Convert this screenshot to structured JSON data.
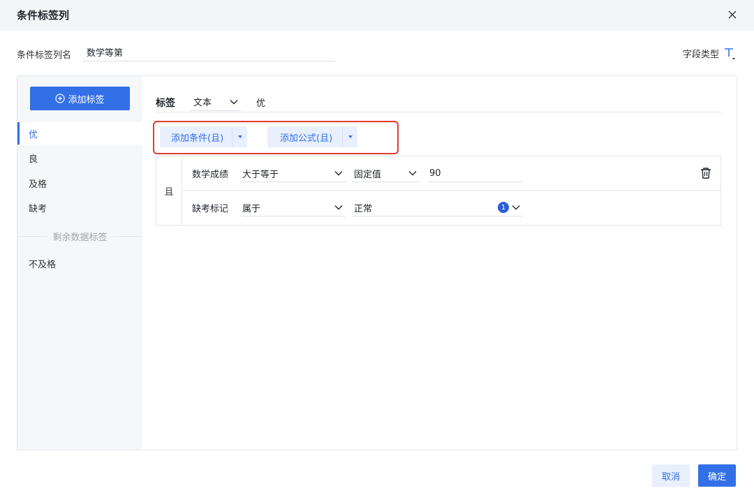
{
  "dialog": {
    "title": "条件标签列",
    "close_icon": "×"
  },
  "column_name": {
    "label": "条件标签列名",
    "value": "数学等第"
  },
  "field_type": {
    "label": "字段类型",
    "icon": "text-type-icon"
  },
  "sidebar": {
    "add_button": "添加标签",
    "tags": [
      "优",
      "良",
      "及格",
      "缺考"
    ],
    "active_index": 0,
    "remaining_label": "剩余数据标签",
    "remaining_tags": [
      "不及格"
    ]
  },
  "label_editor": {
    "title": "标签",
    "type": "文本",
    "value": "优"
  },
  "actions": {
    "add_condition": "添加条件(且)",
    "add_formula": "添加公式(且)",
    "highlight_color": "#e23b2f"
  },
  "conditions": {
    "logic": "且",
    "rows": [
      {
        "field": "数学成绩",
        "operator": "大于等于",
        "value_type": "固定值",
        "value": "90"
      },
      {
        "field": "缺考标记",
        "operator": "属于",
        "value": "正常",
        "selected_count": "1"
      }
    ]
  },
  "footer": {
    "cancel": "取消",
    "confirm": "确定"
  },
  "colors": {
    "primary": "#3370e8",
    "primary_light": "#e8effd",
    "sidebar_bg": "#f6f7f9",
    "header_bg": "#f4f5f7"
  }
}
